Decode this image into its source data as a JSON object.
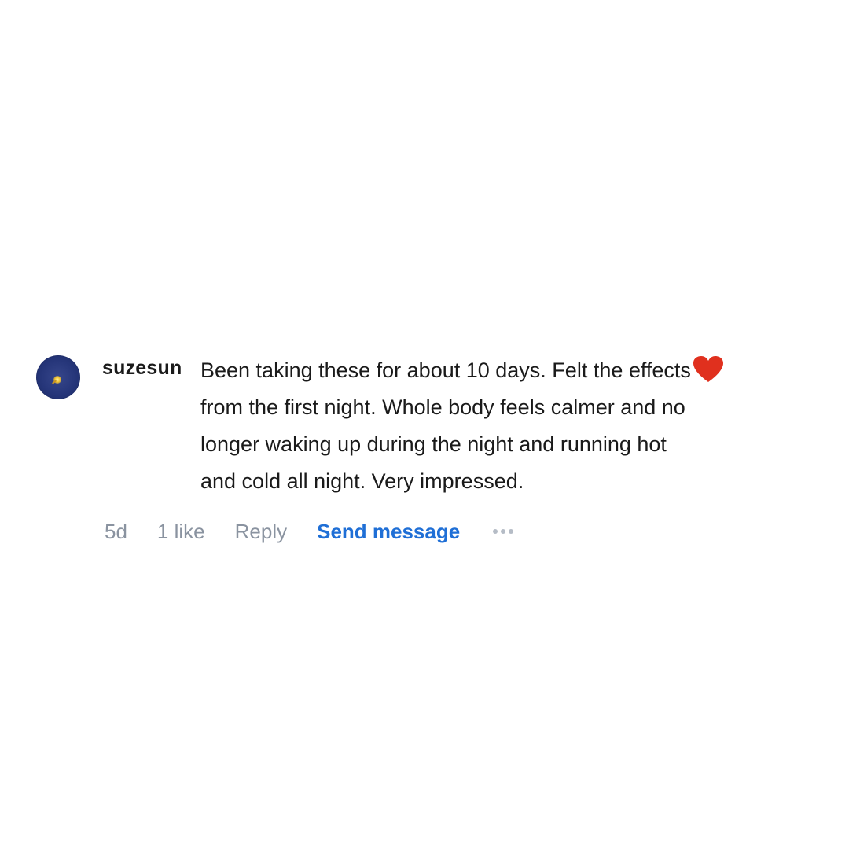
{
  "comment": {
    "username": "suzesun",
    "text_lines": [
      "Been taking these for about 10 days. Felt the effects",
      "from the first night. Whole body feels calmer and no",
      "longer waking up during the night and running hot",
      "and cold all night. Very impressed."
    ],
    "emoji": "heart-icon",
    "heart_color": "#e0301e",
    "avatar_icon": "avatar"
  },
  "actions": {
    "timestamp": "5d",
    "likes": "1 like",
    "reply": "Reply",
    "send_message": "Send message",
    "more_icon": "more-options-icon",
    "send_message_color": "#1f6fd6",
    "muted_color": "#8a93a0"
  }
}
